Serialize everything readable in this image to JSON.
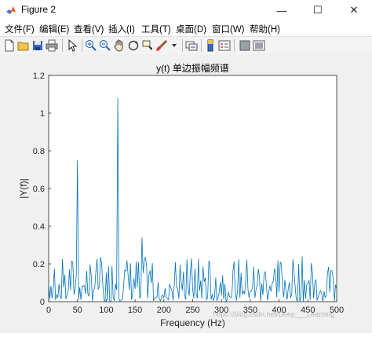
{
  "window": {
    "title": "Figure 2",
    "controls": {
      "minimize": "—",
      "maximize": "☐",
      "close": "✕"
    }
  },
  "menu": [
    {
      "label": "文件(F)"
    },
    {
      "label": "编辑(E)"
    },
    {
      "label": "查看(V)"
    },
    {
      "label": "插入(I)"
    },
    {
      "label": "工具(T)"
    },
    {
      "label": "桌面(D)"
    },
    {
      "label": "窗口(W)"
    },
    {
      "label": "帮助(H)"
    }
  ],
  "toolbar": {
    "icons": [
      "new-figure-icon",
      "open-file-icon",
      "save-icon",
      "print-icon",
      "pointer-icon",
      "zoom-in-icon",
      "zoom-out-icon",
      "pan-icon",
      "rotate-3d-icon",
      "data-cursor-icon",
      "brush-icon",
      "link-plot-icon",
      "colorbar-icon",
      "legend-icon",
      "hide-plot-tools-icon",
      "show-plot-tools-icon"
    ]
  },
  "chart_data": {
    "type": "line",
    "title": "y(t) 单边振幅频谱",
    "xlabel": "Frequency (Hz)",
    "ylabel": "|Y(f)|",
    "xlim": [
      0,
      500
    ],
    "ylim": [
      0,
      1.2
    ],
    "xticks": [
      0,
      50,
      100,
      150,
      200,
      250,
      300,
      350,
      400,
      450,
      500
    ],
    "yticks": [
      0,
      0.2,
      0.4,
      0.6,
      0.8,
      1,
      1.2
    ],
    "ytick_labels": [
      "0",
      "0.2",
      "0.4",
      "0.6",
      "0.8",
      "1",
      "1.2"
    ],
    "grid": false,
    "line_color": "#0072BD",
    "peaks": [
      {
        "x": 50,
        "y": 0.75
      },
      {
        "x": 120,
        "y": 1.08
      },
      {
        "x": 115,
        "y": 0.32
      },
      {
        "x": 162,
        "y": 0.34
      },
      {
        "x": 175,
        "y": 0.36
      }
    ],
    "noise_floor": {
      "x_step": 2,
      "min": 0.0,
      "max": 0.24,
      "typical": 0.1
    },
    "watermark": "https://blog.csdn.net/Deep___Learning"
  }
}
